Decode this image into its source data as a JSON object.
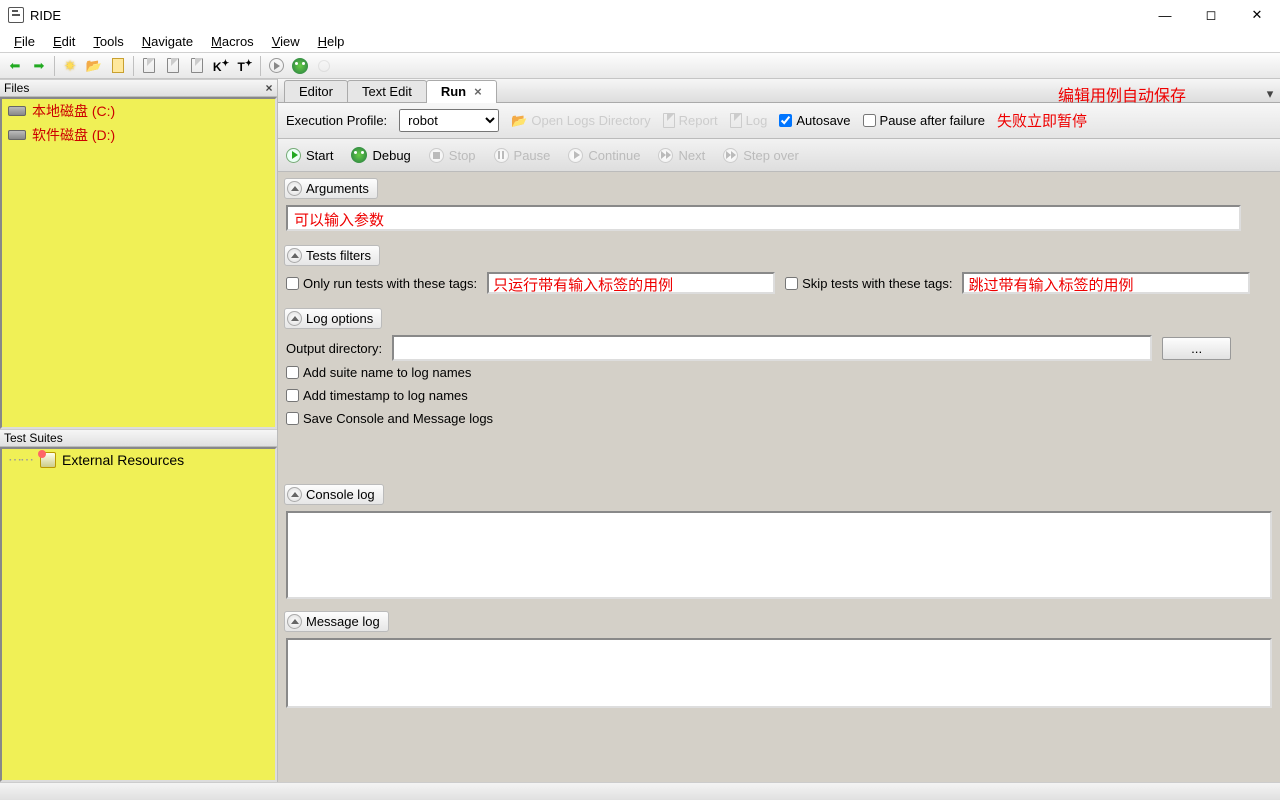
{
  "titlebar": {
    "title": "RIDE"
  },
  "menu": {
    "file": "File",
    "edit": "Edit",
    "tools": "Tools",
    "navigate": "Navigate",
    "macros": "Macros",
    "view": "View",
    "help": "Help"
  },
  "left": {
    "files_title": "Files",
    "files": [
      "本地磁盘 (C:)",
      "软件磁盘 (D:)"
    ],
    "suites_title": "Test Suites",
    "suites": [
      "External Resources"
    ]
  },
  "tabs": {
    "editor": "Editor",
    "text_edit": "Text Edit",
    "run": "Run",
    "autosave_note": "编辑用例自动保存"
  },
  "exec": {
    "profile_label": "Execution Profile:",
    "profile_value": "robot",
    "open_logs": "Open Logs Directory",
    "report": "Report",
    "log": "Log",
    "autosave": "Autosave",
    "autosave_checked": true,
    "pause_after_failure": "Pause after failure",
    "pause_note": "失败立即暂停"
  },
  "controls": {
    "start": "Start",
    "debug": "Debug",
    "stop": "Stop",
    "pause": "Pause",
    "continue": "Continue",
    "next": "Next",
    "step_over": "Step over"
  },
  "sections": {
    "arguments": "Arguments",
    "arguments_hint": "可以输入参数",
    "tests_filters": "Tests filters",
    "only_run_label": "Only run tests with these tags:",
    "only_run_hint": "只运行带有输入标签的用例",
    "skip_label": "Skip tests with these tags:",
    "skip_hint": "跳过带有输入标签的用例",
    "log_options": "Log options",
    "output_dir_label": "Output directory:",
    "browse": "...",
    "add_suite": "Add suite name to log names",
    "add_timestamp": "Add timestamp to log names",
    "save_console": "Save Console and Message logs",
    "console_log": "Console log",
    "message_log": "Message log"
  }
}
